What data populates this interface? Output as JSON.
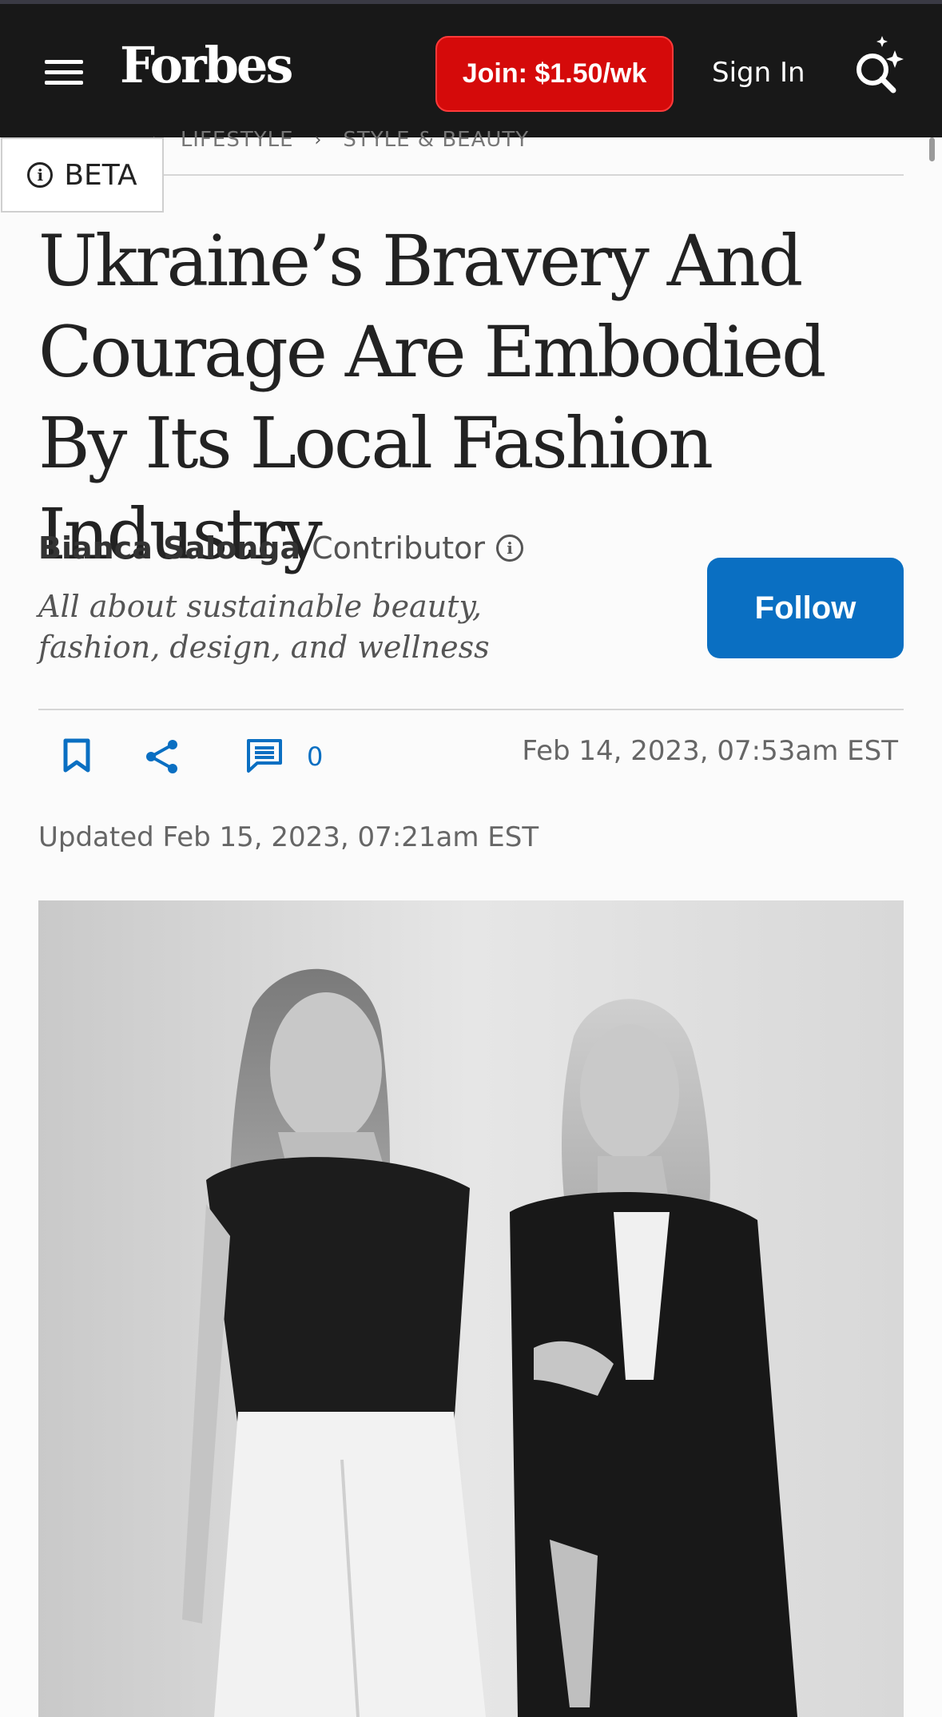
{
  "header": {
    "logo": "Forbes",
    "join_label": "Join: $1.50/wk",
    "signin_label": "Sign In"
  },
  "breadcrumb": [
    "LIFESTYLE",
    "STYLE & BEAUTY"
  ],
  "beta_label": "BETA",
  "article": {
    "headline": "Ukraine’s Bravery And Courage Are Embodied By Its Local Fashion Industry",
    "author_name": "Bianca Salonga",
    "author_role": "Contributor",
    "author_bio": "All about sustainable beauty, fashion, design, and wellness",
    "follow_label": "Follow",
    "comment_count": "0",
    "published": "Feb 14, 2023, 07:53am EST",
    "updated": "Updated Feb 15, 2023, 07:21am EST"
  },
  "icons": [
    "hamburger-icon",
    "search-sparkle-icon",
    "info-icon",
    "bookmark-icon",
    "share-icon",
    "comment-icon"
  ],
  "colors": {
    "header_bg": "#181818",
    "join_red": "#d50a0a",
    "follow_blue": "#0a6fc2"
  }
}
